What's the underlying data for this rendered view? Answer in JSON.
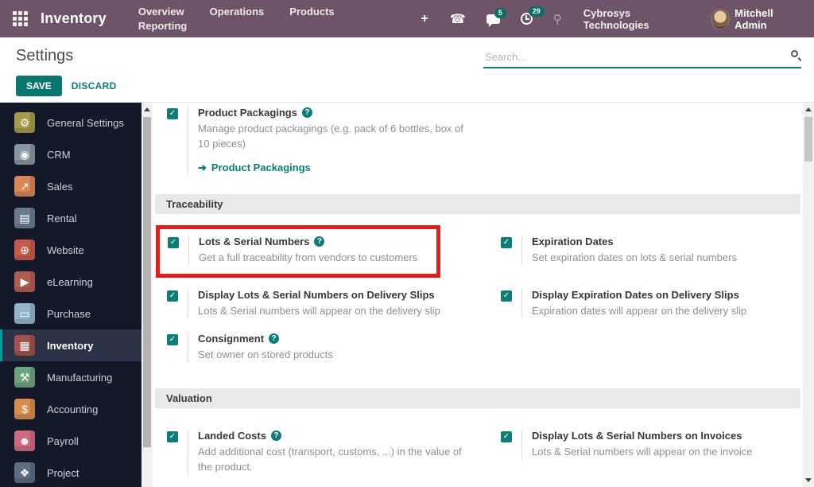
{
  "topbar": {
    "app_name": "Inventory",
    "menus": [
      "Overview",
      "Operations",
      "Products",
      "Reporting"
    ],
    "plus_label": "+",
    "messages_badge": "5",
    "activities_badge": "29",
    "company": "Cybrosys Technologies",
    "user": "Mitchell Admin",
    "bg_color": "#6d5468",
    "badge_color": "#0d6e68"
  },
  "control_panel": {
    "title": "Settings",
    "search_placeholder": "Search...",
    "save_label": "SAVE",
    "discard_label": "DISCARD",
    "accent_color": "#0b7d78"
  },
  "sidebar": {
    "items": [
      {
        "label": "General Settings",
        "icon": "gear-icon",
        "glyph": "⚙",
        "color": "#a79a4a",
        "active": false
      },
      {
        "label": "CRM",
        "icon": "handshake-icon",
        "glyph": "◉",
        "color": "#8a96a2",
        "active": false
      },
      {
        "label": "Sales",
        "icon": "chart-icon",
        "glyph": "↗",
        "color": "#d98757",
        "active": false
      },
      {
        "label": "Rental",
        "icon": "rental-icon",
        "glyph": "▤",
        "color": "#6b7b8e",
        "active": false
      },
      {
        "label": "Website",
        "icon": "globe-icon",
        "glyph": "⊕",
        "color": "#c75a4a",
        "active": false
      },
      {
        "label": "eLearning",
        "icon": "screen-icon",
        "glyph": "▶",
        "color": "#b05e55",
        "active": false
      },
      {
        "label": "Purchase",
        "icon": "card-icon",
        "glyph": "▭",
        "color": "#92b5c9",
        "active": false
      },
      {
        "label": "Inventory",
        "icon": "box-icon",
        "glyph": "▦",
        "color": "#a0524d",
        "active": true
      },
      {
        "label": "Manufacturing",
        "icon": "wrench-icon",
        "glyph": "⚒",
        "color": "#6fa380",
        "active": false
      },
      {
        "label": "Accounting",
        "icon": "invoice-icon",
        "glyph": "$",
        "color": "#d78d4e",
        "active": false
      },
      {
        "label": "Payroll",
        "icon": "person-icon",
        "glyph": "☻",
        "color": "#ce6b80",
        "active": false
      },
      {
        "label": "Project",
        "icon": "puzzle-icon",
        "glyph": "❖",
        "color": "#5e6d81",
        "active": false
      }
    ]
  },
  "main": {
    "product_packagings": {
      "label": "Product Packagings",
      "desc": "Manage product packagings (e.g. pack of 6 bottles, box of 10 pieces)",
      "link_arrow": "➔",
      "link_label": "Product Packagings"
    },
    "traceability": {
      "header": "Traceability",
      "lots_serial": {
        "label": "Lots & Serial Numbers",
        "desc": "Get a full traceability from vendors to customers",
        "highlight_color": "#e0201c"
      },
      "expiration_dates": {
        "label": "Expiration Dates",
        "desc": "Set expiration dates on lots & serial numbers"
      },
      "display_lots_slips": {
        "label": "Display Lots & Serial Numbers on Delivery Slips",
        "desc": "Lots & Serial numbers will appear on the delivery slip"
      },
      "display_expiration_slips": {
        "label": "Display Expiration Dates on Delivery Slips",
        "desc": "Expiration dates will appear on the delivery slip"
      },
      "consignment": {
        "label": "Consignment",
        "desc": "Set owner on stored products"
      }
    },
    "valuation": {
      "header": "Valuation",
      "landed_costs": {
        "label": "Landed Costs",
        "desc": "Add additional cost (transport, customs, ...) in the value of the product."
      },
      "display_lots_invoices": {
        "label": "Display Lots & Serial Numbers on Invoices",
        "desc": "Lots & Serial numbers will appear on the invoice"
      }
    },
    "icons": {
      "check": "✓",
      "help": "?"
    }
  }
}
